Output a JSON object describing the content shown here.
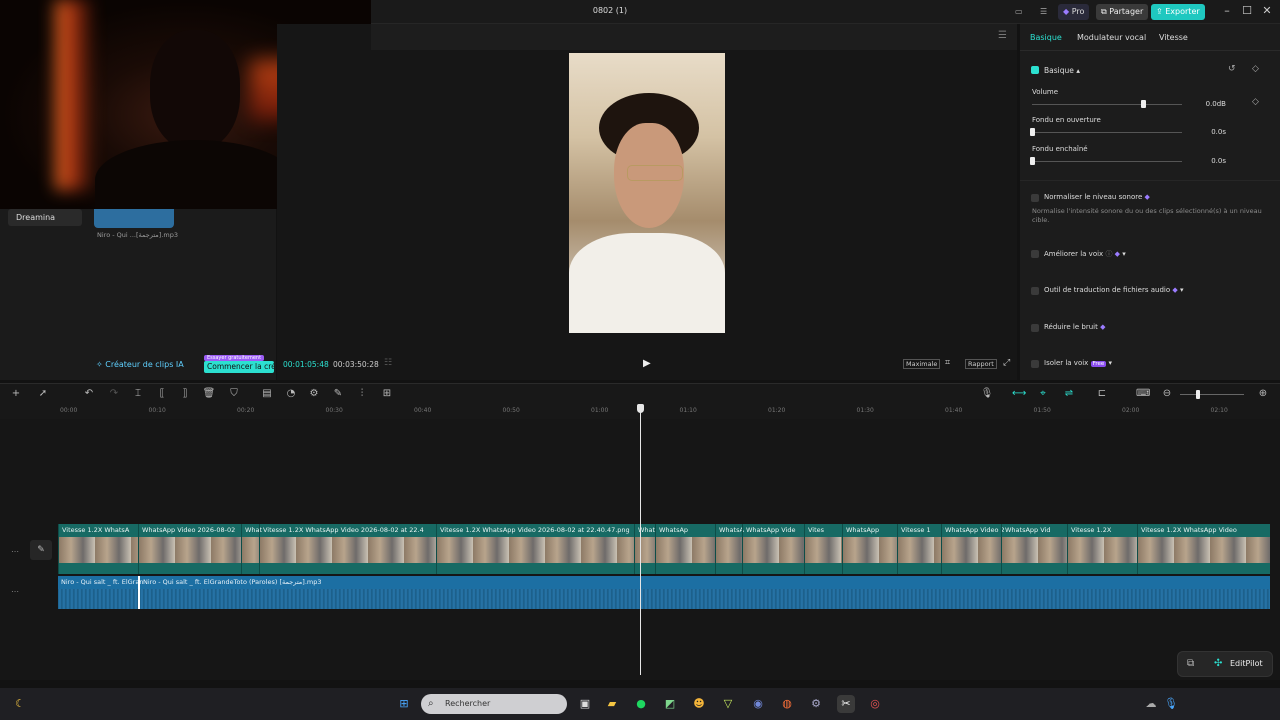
{
  "window": {
    "title": "0802 (1)",
    "pro_label": "Pro",
    "share_label": "Partager",
    "export_label": "Exporter"
  },
  "media": {
    "side_item": "Dreamina",
    "file_name": "Niro - Qui ...[مترجمة].mp3",
    "ai_label": "Créateur de clips IA",
    "trial_badge": "Essayer gratuitement",
    "start_label": "Commencer la cré"
  },
  "player": {
    "current_time": "00:01:05:48",
    "total_time": "00:03:50:28",
    "maximize_label": "Maximale",
    "ratio_label": "Rapport"
  },
  "properties": {
    "tabs": [
      "Basique",
      "Modulateur vocal",
      "Vitesse"
    ],
    "section_title": "Basique",
    "volume_label": "Volume",
    "volume_value": "0.0dB",
    "volume_level": 0.74,
    "fade_in_label": "Fondu en ouverture",
    "fade_in_value": "0.0s",
    "fade_out_label": "Fondu enchaîné",
    "fade_out_value": "0.0s",
    "normalize_label": "Normaliser le niveau sonore",
    "normalize_desc": "Normalise l'intensité sonore du ou des clips sélectionné(s) à un niveau cible.",
    "enhance_label": "Améliorer la voix",
    "translate_label": "Outil de traduction de fichiers audio",
    "noise_label": "Réduire le bruit",
    "isolate_label": "Isoler la voix",
    "free_badge": "Free"
  },
  "timeline": {
    "ticks": [
      "00:00",
      "00:10",
      "00:20",
      "00:30",
      "00:40",
      "00:50",
      "01:00",
      "01:10",
      "01:20",
      "01:30",
      "01:40",
      "01:50",
      "02:00",
      "02:10"
    ],
    "video_clips": [
      "Vitesse 1.2X  WhatsA",
      "WhatsApp Video 2026-08-02",
      "What",
      "Vitesse 1.2X  WhatsApp Video 2026-08-02 at 22.4",
      "Vitesse 1.2X  WhatsApp Video 2026-08-02 at 22.40.47.png",
      "What",
      "WhatsAp",
      "WhatsA",
      "WhatsApp Vide",
      "Vites",
      "WhatsApp",
      "Vitesse 1",
      "WhatsApp Video 2",
      "WhatsApp Vid",
      "Vitesse 1.2X",
      "Vitesse 1.2X  WhatsApp Video"
    ],
    "audio_clips": [
      "Niro - Qui salt _ ft. ElGran",
      "Niro - Qui salt _ ft. ElGrandeToto (Paroles) [مترجمة].mp3"
    ]
  },
  "editpilot_label": "EditPilot",
  "taskbar": {
    "search_placeholder": "Rechercher"
  }
}
